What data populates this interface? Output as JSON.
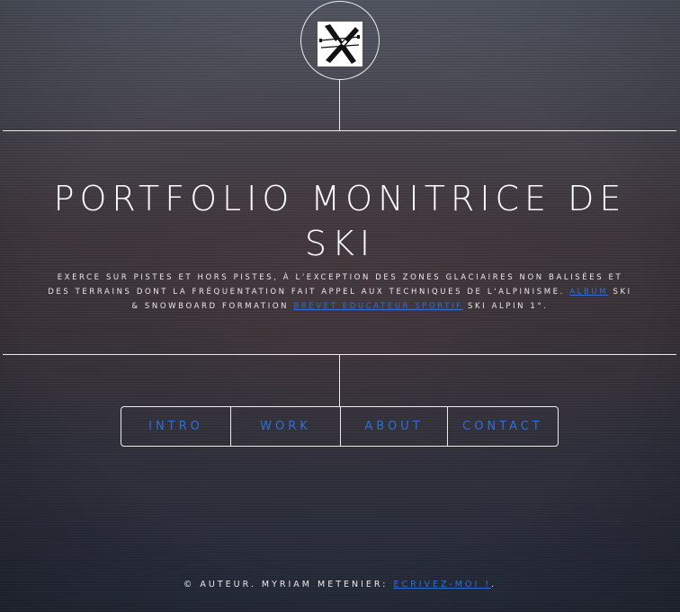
{
  "logo": {
    "icon": "crossed-skis-icon"
  },
  "title": "PORTFOLIO MONITRICE DE SKI",
  "intro": {
    "text_1": "EXERCE SUR PISTES ET HORS PISTES, À L'EXCEPTION DES ZONES GLACIAIRES NON BALISÉES ET DES TERRAINS DONT LA FRÉQUENTATION FAIT APPEL AUX TECHNIQUES DE L'ALPINISME.",
    "link_album": "ALBUM",
    "text_2": "SKI & SNOWBOARD FORMATION",
    "link_brevet": "BREVET EDUCATEUR SPORTIF",
    "text_3": "SKI ALPIN 1°."
  },
  "nav": {
    "items": [
      {
        "label": "INTRO"
      },
      {
        "label": "WORK"
      },
      {
        "label": "ABOUT"
      },
      {
        "label": "CONTACT"
      }
    ]
  },
  "footer": {
    "copyright": "© AUTEUR. MYRIAM METENIER:",
    "contact_link": "ECRIVEZ-MOI !",
    "trailing": "."
  },
  "colors": {
    "link": "#2f6fd6",
    "text": "#ffffff",
    "border": "#ffffff"
  }
}
